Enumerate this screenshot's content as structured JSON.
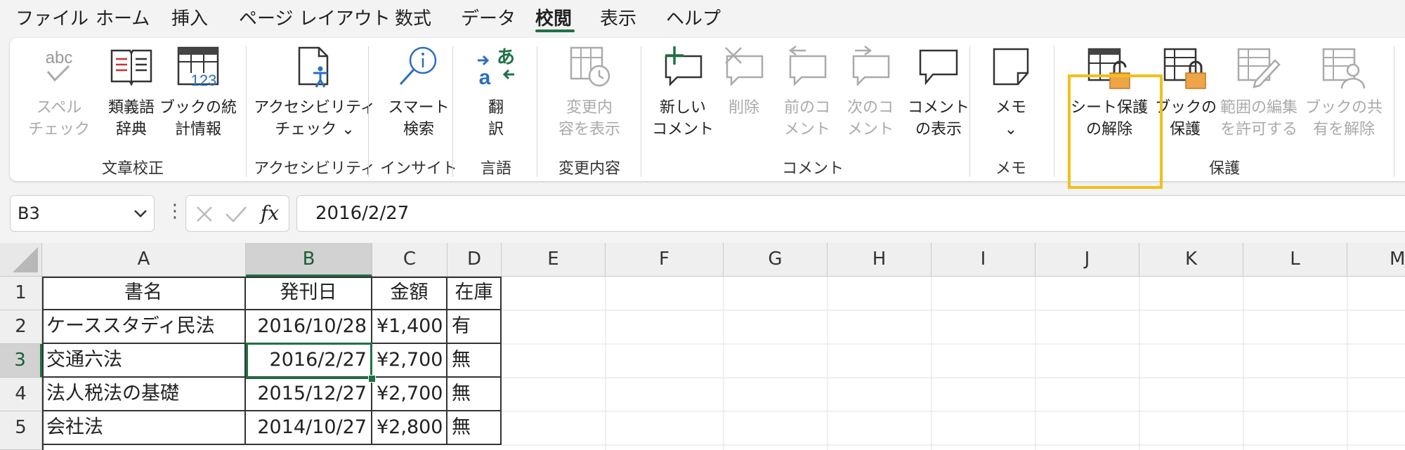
{
  "menu": {
    "tabs": [
      "ファイル",
      "ホーム",
      "挿入",
      "ページ レイアウト",
      "数式",
      "データ",
      "校閲",
      "表示",
      "ヘルプ"
    ],
    "active": "校閲"
  },
  "ribbon": {
    "groups": {
      "proofing": "文章校正",
      "accessibility": "アクセシビリティ",
      "insights": "インサイト",
      "language": "言語",
      "changes": "変更内容",
      "comments": "コメント",
      "notes": "メモ",
      "protect": "保護"
    },
    "buttons": {
      "spelling": [
        "スペル",
        "チェック"
      ],
      "thesaurus": [
        "類義語",
        "辞典"
      ],
      "workbook_stats": [
        "ブックの統",
        "計情報"
      ],
      "check_accessibility": [
        "アクセシビリティ",
        "チェック ⌄"
      ],
      "smart_lookup": [
        "スマート",
        "検索"
      ],
      "translate": [
        "翻",
        "訳"
      ],
      "show_changes": [
        "変更内",
        "容を表示"
      ],
      "new_comment": [
        "新しい",
        "コメント"
      ],
      "delete": [
        "削除",
        ""
      ],
      "previous_comment": [
        "前のコ",
        "メント"
      ],
      "next_comment": [
        "次のコ",
        "メント"
      ],
      "show_comments": [
        "コメント",
        "の表示"
      ],
      "notes": [
        "メモ",
        "⌄"
      ],
      "unprotect_sheet": [
        "シート保護",
        "の解除"
      ],
      "protect_workbook": [
        "ブックの",
        "保護"
      ],
      "allow_edit_ranges": [
        "範囲の編集",
        "を許可する"
      ],
      "unshare_workbook": [
        "ブックの共",
        "有を解除"
      ]
    },
    "icon_text": {
      "abc": "abc",
      "num123": "123",
      "aji": "あ",
      "a": "a"
    }
  },
  "formula_bar": {
    "name_box": "B3",
    "more": "⋮",
    "fx": "fx",
    "formula": "2016/2/27"
  },
  "sheet": {
    "columns": [
      "A",
      "B",
      "C",
      "D",
      "E",
      "F",
      "G",
      "H",
      "I",
      "J",
      "K",
      "L",
      "M"
    ],
    "rows": [
      "1",
      "2",
      "3",
      "4",
      "5"
    ],
    "selected_cell": "B3",
    "cells": [
      [
        "書名",
        "発刊日",
        "金額",
        "在庫"
      ],
      [
        "ケーススタディ民法",
        "2016/10/28",
        "¥1,400",
        "有"
      ],
      [
        "交通六法",
        "2016/2/27",
        "¥2,700",
        "無"
      ],
      [
        "法人税法の基礎",
        "2015/12/27",
        "¥2,700",
        "無"
      ],
      [
        "会社法",
        "2014/10/27",
        "¥2,800",
        "無"
      ]
    ]
  },
  "colors": {
    "accent_green": "#1e7145",
    "highlight_yellow": "#f3c01b",
    "lock_orange": "#f0a44a"
  }
}
